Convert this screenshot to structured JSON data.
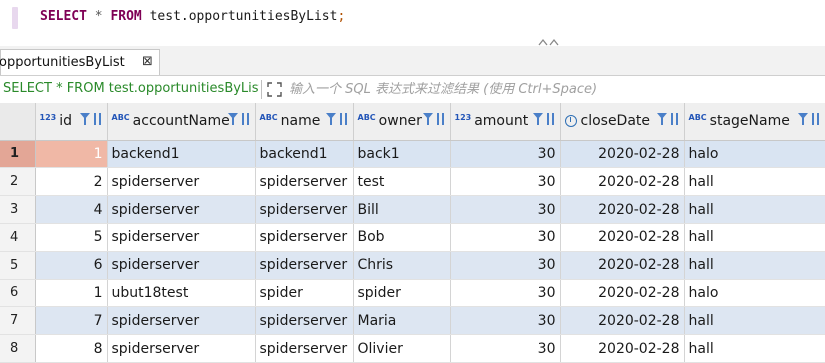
{
  "editor": {
    "sql": {
      "kw_select": "SELECT",
      "star": " * ",
      "kw_from": "FROM",
      "table": " test.opportunitiesByList",
      "semi": ";"
    }
  },
  "tab": {
    "label": "opportunitiesByList",
    "close": "⊠"
  },
  "filter": {
    "query": "SELECT * FROM test.opportunitiesByList",
    "placeholder": "输入一个 SQL 表达式来过滤结果 (使用 Ctrl+Space)"
  },
  "columns": [
    {
      "key": "id",
      "label": "id",
      "type_badge": "123"
    },
    {
      "key": "accountName",
      "label": "accountName",
      "type_badge": "ABC"
    },
    {
      "key": "name",
      "label": "name",
      "type_badge": "ABC"
    },
    {
      "key": "owner",
      "label": "owner",
      "type_badge": "ABC"
    },
    {
      "key": "amount",
      "label": "amount",
      "type_badge": "123"
    },
    {
      "key": "closeDate",
      "label": "closeDate",
      "type_badge": "clock"
    },
    {
      "key": "stageName",
      "label": "stageName",
      "type_badge": "ABC"
    }
  ],
  "rows": [
    {
      "n": "1",
      "id": "1",
      "accountName": "backend1",
      "name": "backend1",
      "owner": "back1",
      "amount": "30",
      "closeDate": "2020-02-28",
      "stageName": "halo"
    },
    {
      "n": "2",
      "id": "2",
      "accountName": "spiderserver",
      "name": "spiderserver",
      "owner": "test",
      "amount": "30",
      "closeDate": "2020-02-28",
      "stageName": "hall"
    },
    {
      "n": "3",
      "id": "4",
      "accountName": "spiderserver",
      "name": "spiderserver",
      "owner": "Bill",
      "amount": "30",
      "closeDate": "2020-02-28",
      "stageName": "hall"
    },
    {
      "n": "4",
      "id": "5",
      "accountName": "spiderserver",
      "name": "spiderserver",
      "owner": "Bob",
      "amount": "30",
      "closeDate": "2020-02-28",
      "stageName": "hall"
    },
    {
      "n": "5",
      "id": "6",
      "accountName": "spiderserver",
      "name": "spiderserver",
      "owner": "Chris",
      "amount": "30",
      "closeDate": "2020-02-28",
      "stageName": "hall"
    },
    {
      "n": "6",
      "id": "1",
      "accountName": "ubut18test",
      "name": "spider",
      "owner": "spider",
      "amount": "30",
      "closeDate": "2020-02-28",
      "stageName": "halo"
    },
    {
      "n": "7",
      "id": "7",
      "accountName": "spiderserver",
      "name": "spiderserver",
      "owner": "Maria",
      "amount": "30",
      "closeDate": "2020-02-28",
      "stageName": "hall"
    },
    {
      "n": "8",
      "id": "8",
      "accountName": "spiderserver",
      "name": "spiderserver",
      "owner": "Olivier",
      "amount": "30",
      "closeDate": "2020-02-28",
      "stageName": "hall"
    }
  ],
  "colors": {
    "keyword": "#7f0055",
    "query_green": "#2a8a2a",
    "row_stripe": "#dde6f2",
    "selected_cell": "#f0b8a6",
    "icon_blue": "#4a7fc8"
  }
}
